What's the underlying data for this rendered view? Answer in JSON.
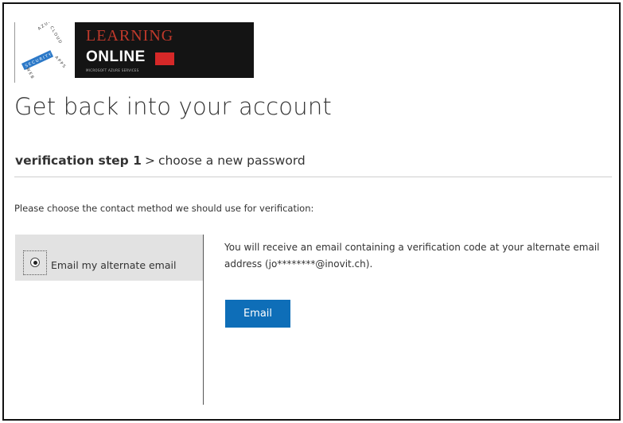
{
  "logo": {
    "brand_line1": "LEARNING",
    "brand_line2": "ONLINE",
    "brand_tagline": "MICROSOFT AZURE SERVICES",
    "colors": {
      "background": "#141414",
      "accent": "#d62828",
      "text": "#ffffff"
    }
  },
  "page": {
    "title": "Get back into your account"
  },
  "steps": {
    "current": "verification step 1",
    "separator": ">",
    "next": "choose a new password"
  },
  "prompt": "Please choose the contact method we should use for verification:",
  "methods": [
    {
      "label": "Email my alternate email",
      "selected": true
    }
  ],
  "detail": {
    "text": "You will receive an email containing a verification code at your alternate email address (jo********@inovit.ch).",
    "button_label": "Email"
  },
  "colors": {
    "primary_button": "#0e6eb8",
    "selected_method_bg": "#e2e2e2",
    "divider": "#cfcfcf"
  }
}
